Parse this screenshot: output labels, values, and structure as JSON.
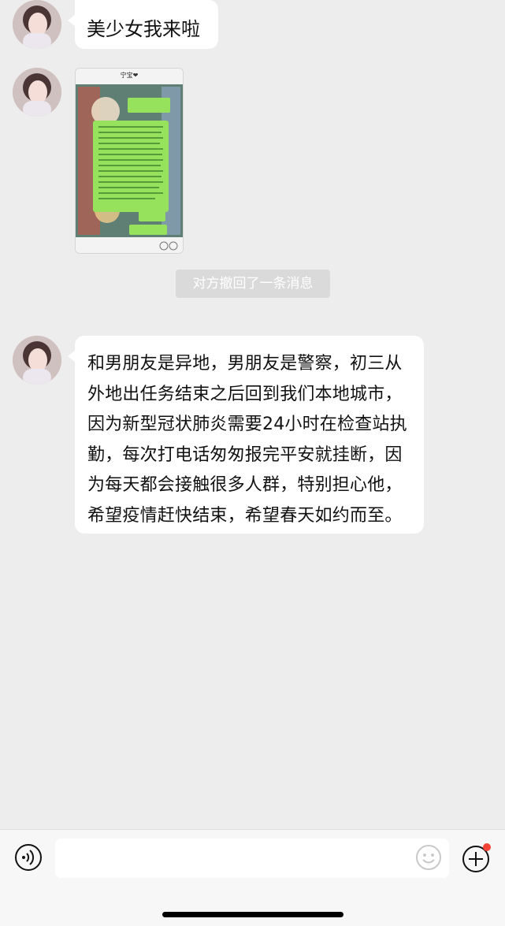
{
  "messages": [
    {
      "text": "美少女我来啦"
    },
    {
      "text": "和男朋友是异地，男朋友是警察，初三从外地出任务结束之后回到我们本地城市，因为新型冠状肺炎需要24小时在检查站执勤，每次打电话匆匆报完平安就挂断，因为每天都会接触很多人群，特别担心他，希望疫情赶快结束，希望春天如约而至。"
    }
  ],
  "system_notice": "对方撤回了一条消息",
  "thumbnail": {
    "header_name": "宁宝❤"
  },
  "toolbar": {
    "voice_icon": "voice-icon",
    "emoji_icon": "emoji-icon",
    "plus_icon": "plus-icon"
  }
}
